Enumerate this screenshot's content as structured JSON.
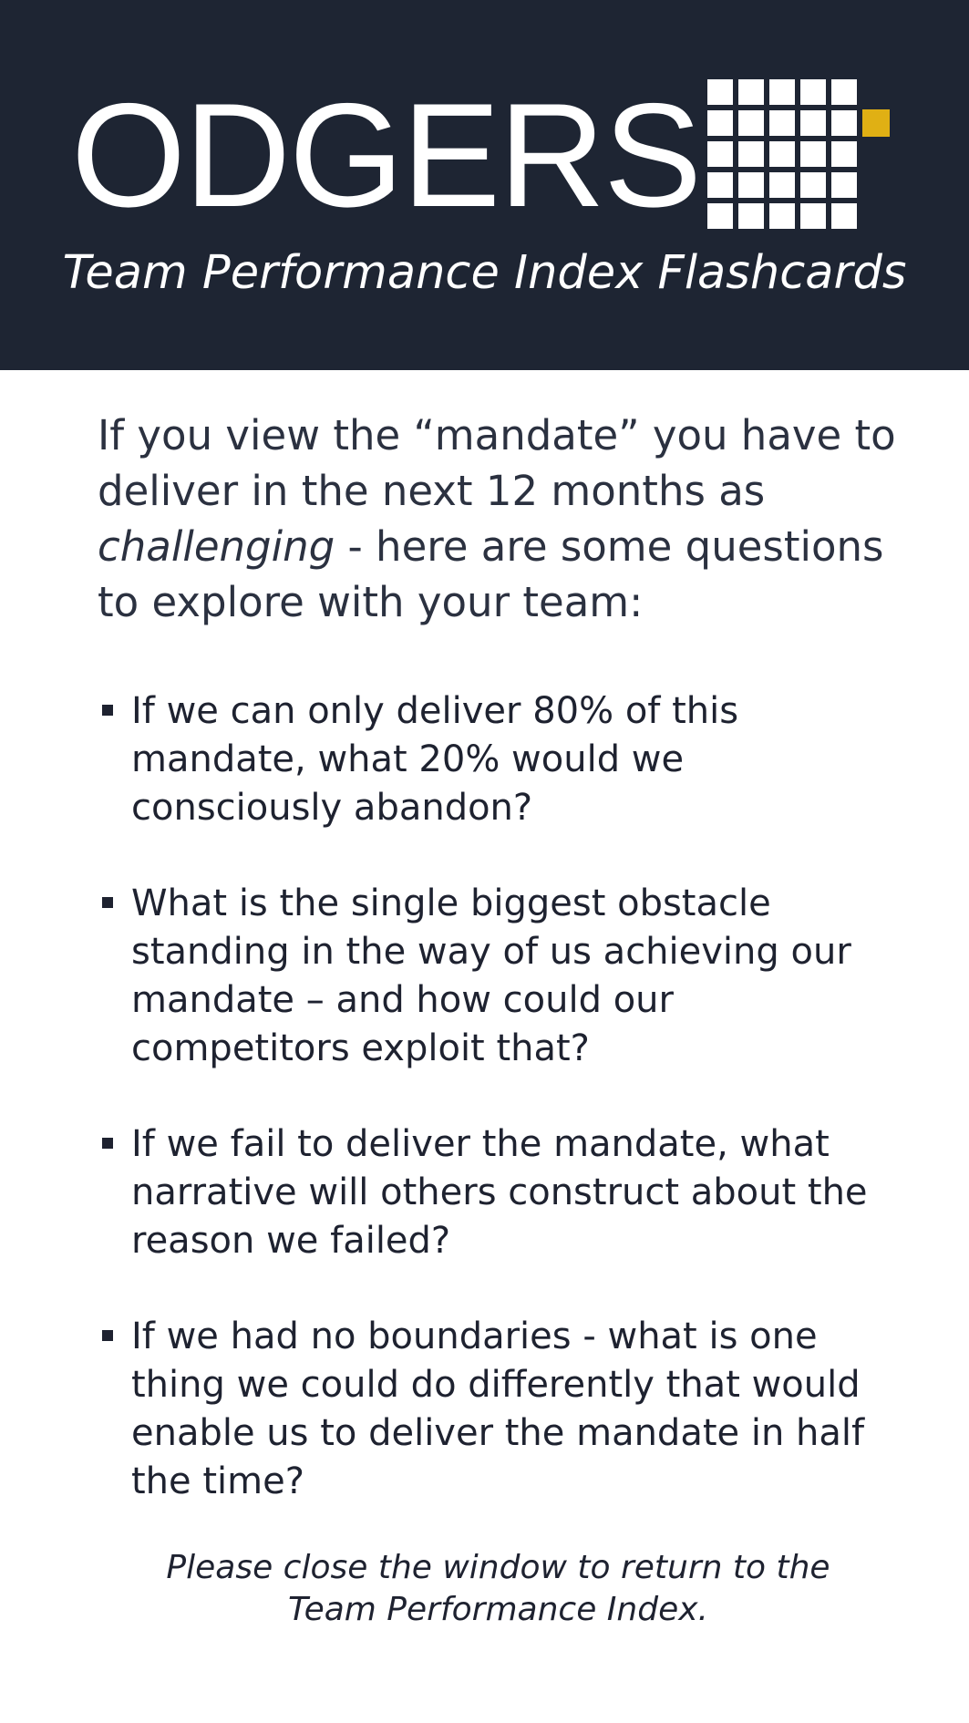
{
  "header": {
    "logo_text": "ODGERS",
    "subtitle": "Team Performance Index Flashcards",
    "colors": {
      "background": "#1e2533",
      "accent": "#e0b014",
      "text": "#ffffff"
    }
  },
  "intro": {
    "text_before": "If you view the “mandate” you have to deliver in the next 12 months as",
    "emphasis": "challenging",
    "text_after": " - here are some questions to explore with your team:"
  },
  "questions": [
    "If we can only deliver 80% of this mandate, what 20% would we consciously abandon?",
    "What is the single biggest obstacle standing in the way of us achieving our mandate – and how could our competitors exploit that?",
    "If we fail to deliver the mandate, what narrative will others construct about the reason we failed?",
    "If we had no boundaries - what is one thing we could do differently that would enable us to deliver the mandate in half the time?"
  ],
  "footer": {
    "line1": "Please close the window to return to the",
    "line2": "Team Performance Index."
  },
  "icons": {
    "bullet": "square-bullet-icon",
    "logo": "odgers-grid-logo-icon"
  }
}
